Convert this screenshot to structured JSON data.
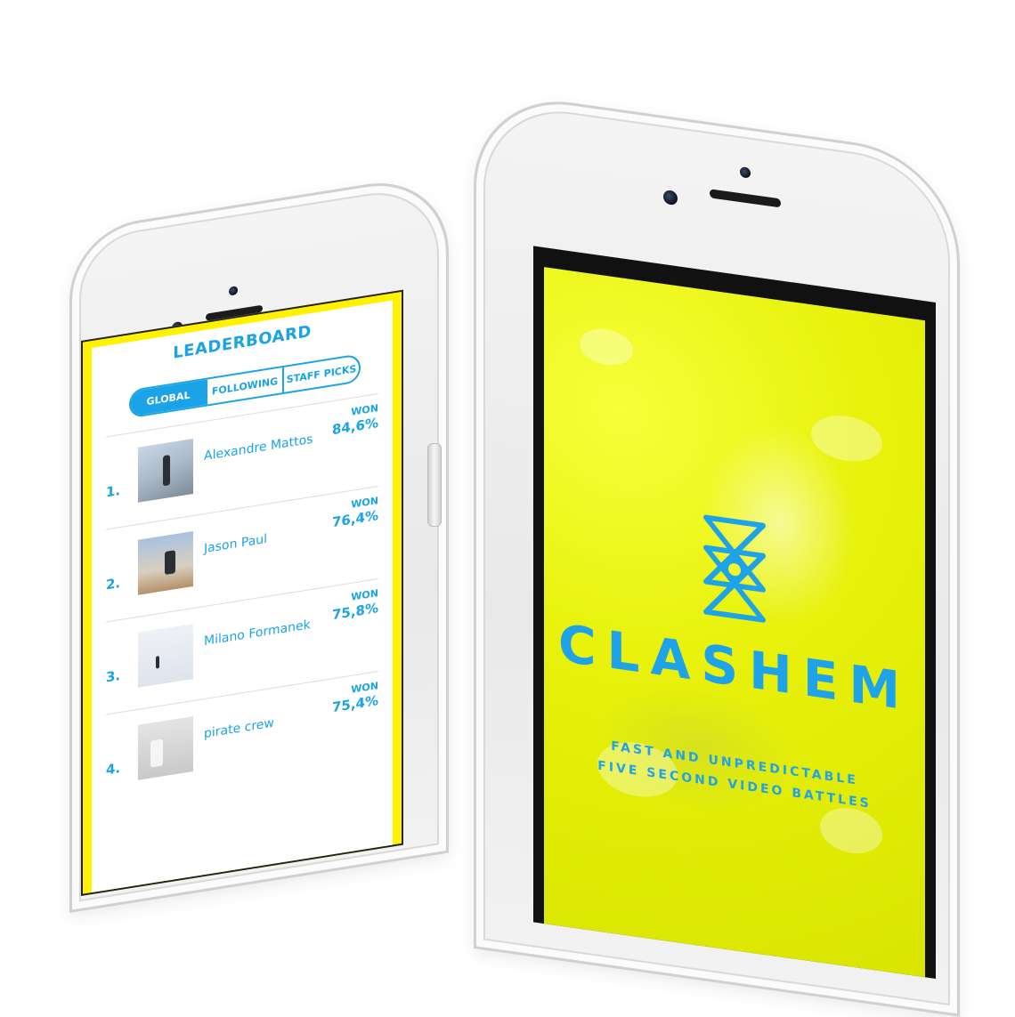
{
  "left_screen": {
    "title": "LEADERBOARD",
    "tabs": [
      {
        "label": "GLOBAL",
        "active": true
      },
      {
        "label": "FOLLOWING",
        "active": false
      },
      {
        "label": "STAFF PICKS",
        "active": false
      }
    ],
    "rows": [
      {
        "rank": "1.",
        "name": "Alexandre Mattos",
        "won_label": "WON",
        "won_value": "84,6%"
      },
      {
        "rank": "2.",
        "name": "Jason Paul",
        "won_label": "WON",
        "won_value": "76,4%"
      },
      {
        "rank": "3.",
        "name": "Milano Formanek",
        "won_label": "WON",
        "won_value": "75,8%"
      },
      {
        "rank": "4.",
        "name": "pirate crew",
        "won_label": "WON",
        "won_value": "75,4%"
      }
    ]
  },
  "right_screen": {
    "brand": "CLASHEM",
    "tagline_line1": "FAST AND UNPREDICTABLE",
    "tagline_line2": "FIVE SECOND VIDEO BATTLES",
    "logo_icon": "clashem-logo-icon"
  },
  "colors": {
    "accent_blue": "#1aa3e6",
    "screen_yellow": "#fff200"
  }
}
